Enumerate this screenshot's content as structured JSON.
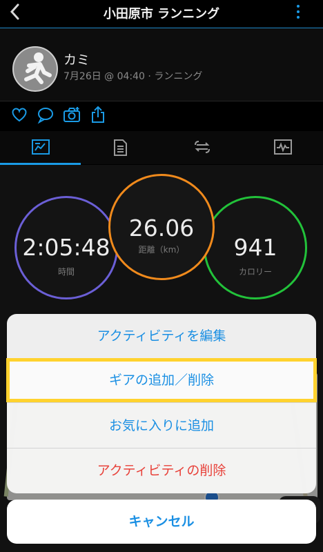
{
  "header": {
    "title": "小田原市 ランニング"
  },
  "profile": {
    "name": "カミ",
    "subtitle": "7月26日 @ 04:40 · ランニング"
  },
  "stats": [
    {
      "value": "2:05:48",
      "label": "時間",
      "color": "#6b5fd6"
    },
    {
      "value": "26.06",
      "label": "距離（km）",
      "color": "#f08a1c"
    },
    {
      "value": "941",
      "label": "カロリー",
      "color": "#22c23a"
    }
  ],
  "sheet": {
    "options": [
      {
        "label": "アクティビティを編集"
      },
      {
        "label": "ギアの追加／削除"
      },
      {
        "label": "お気に入りに追加"
      },
      {
        "label": "アクティビティの削除"
      }
    ],
    "cancel": "キャンセル"
  },
  "colors": {
    "accent": "#1a8fe3",
    "destructive": "#e8413a",
    "highlight": "#ffd22e"
  }
}
